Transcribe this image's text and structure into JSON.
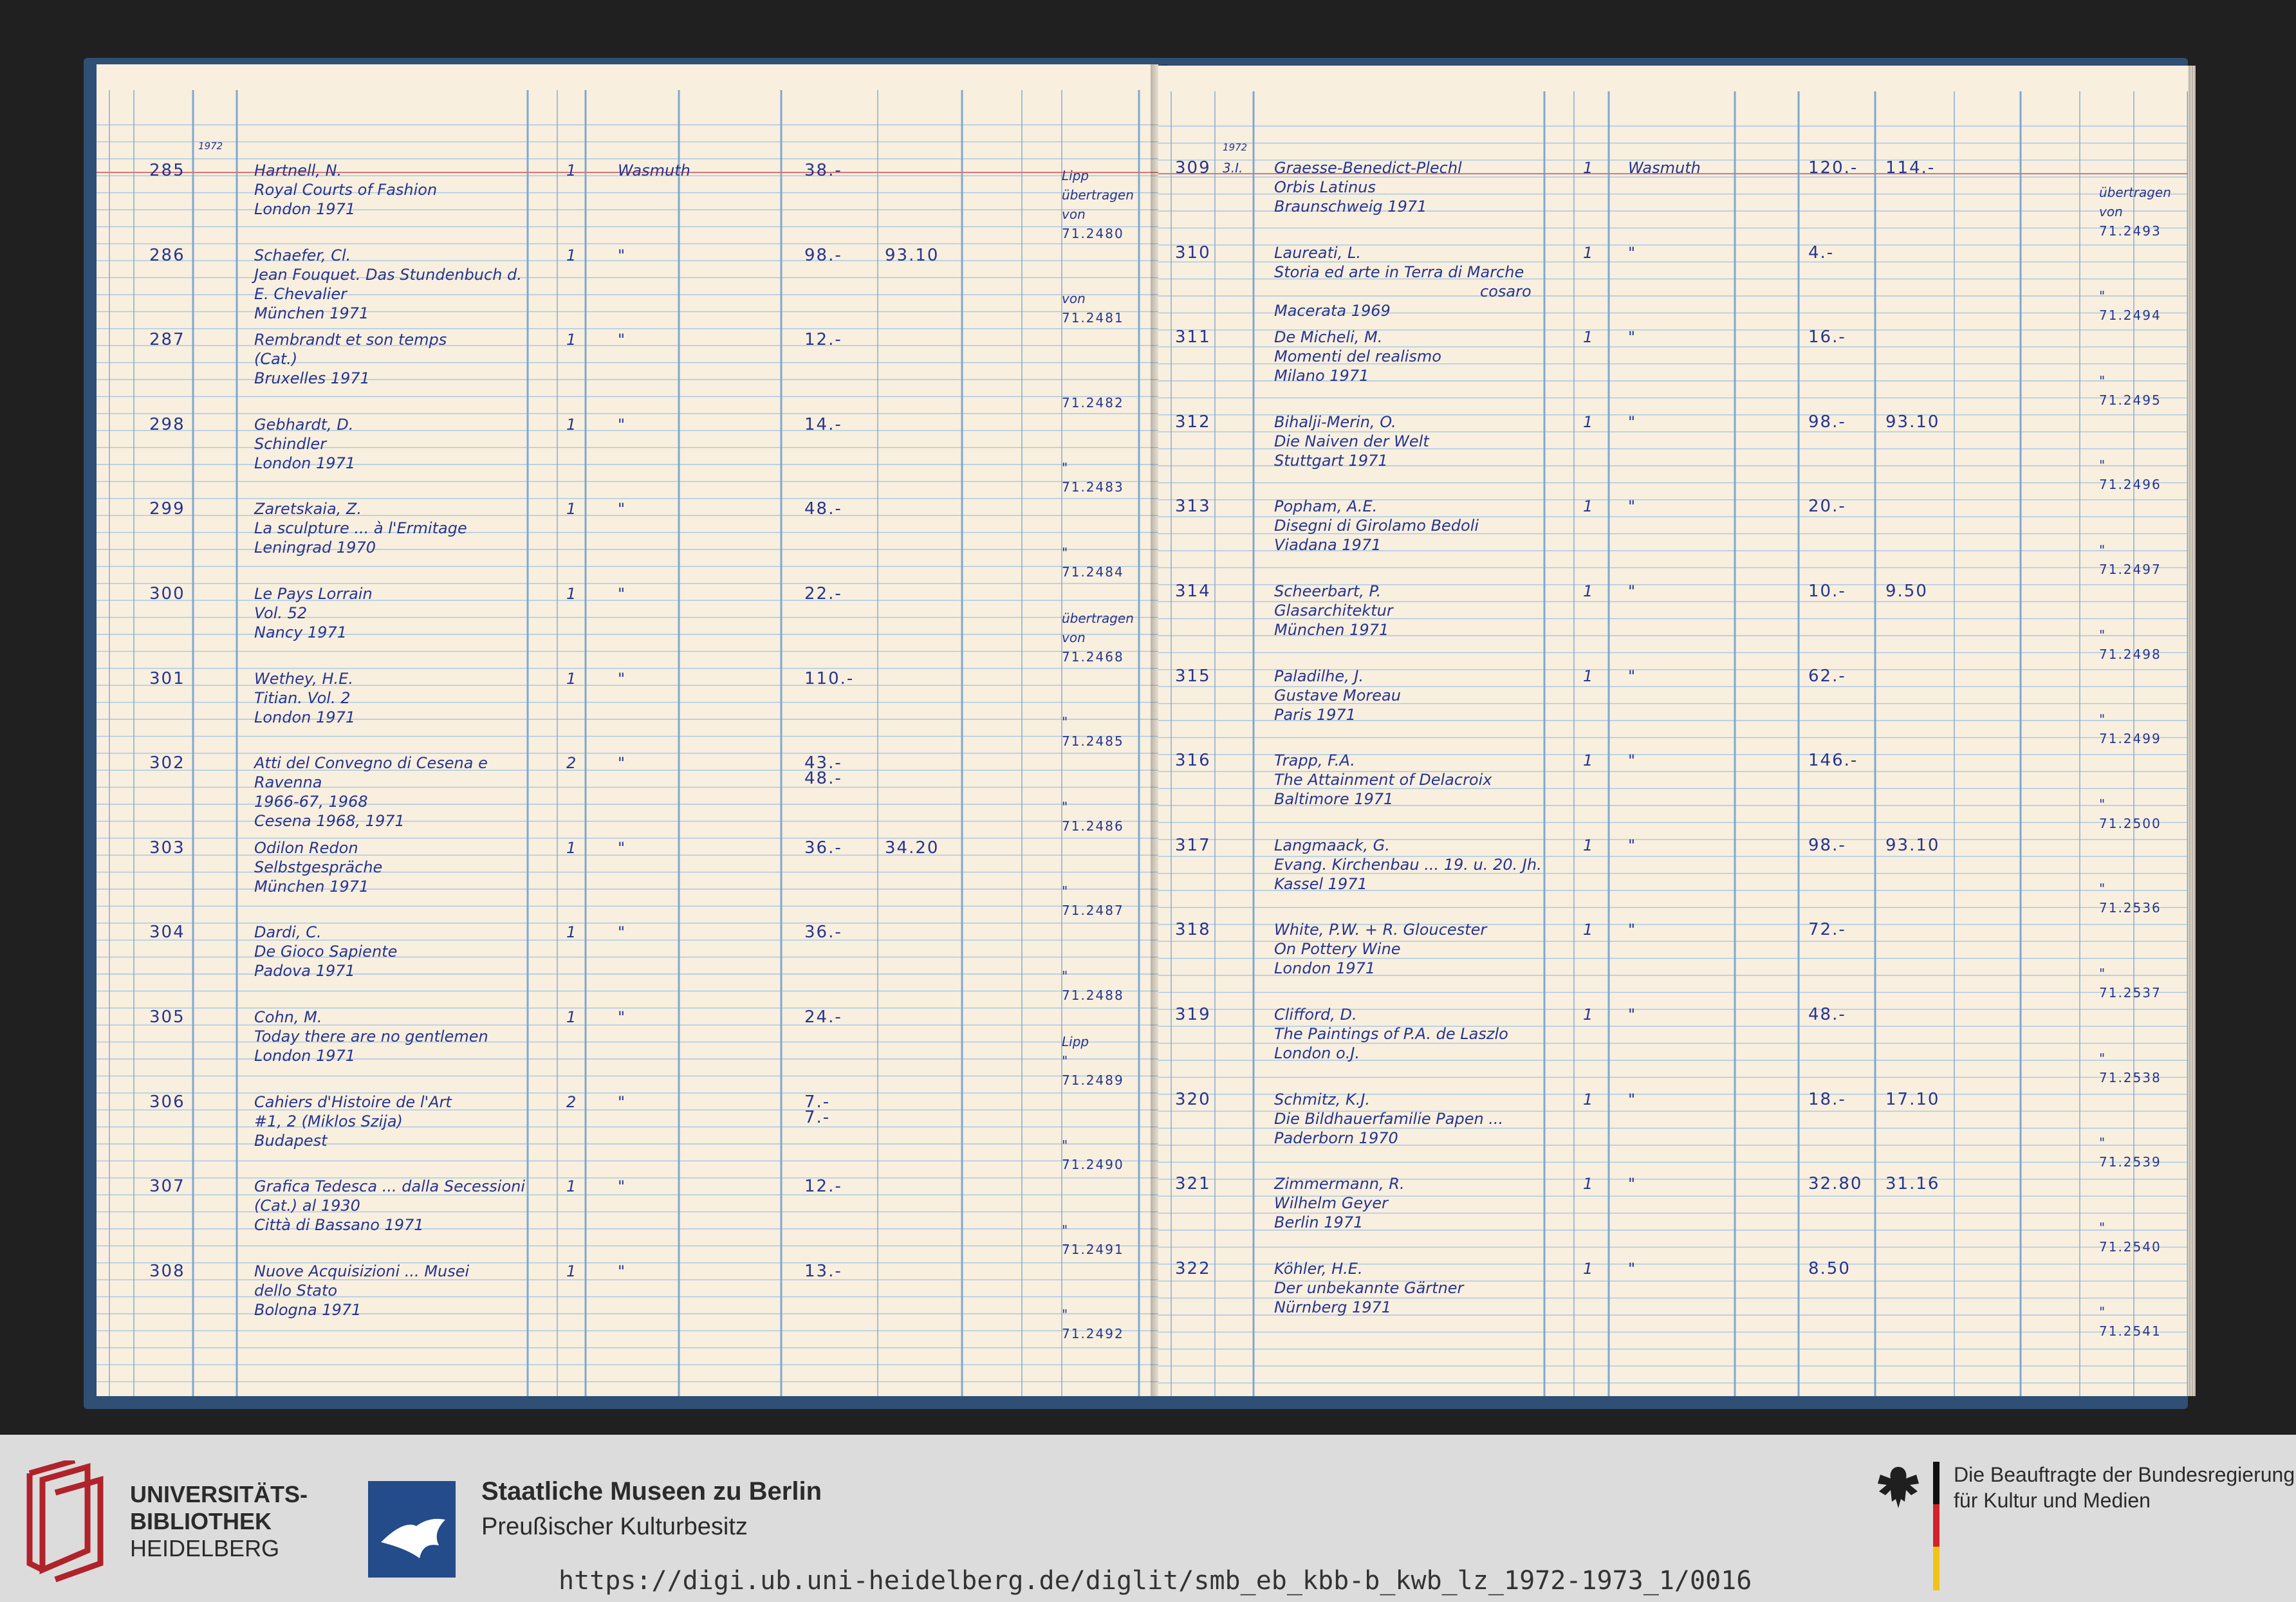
{
  "left_page": {
    "year": "1972",
    "entries": [
      {
        "no": "285",
        "lines": [
          "Hartnell, N.",
          "Royal Courts of Fashion",
          "London 1971"
        ],
        "count": "1",
        "dealer": "Wasmuth",
        "price": "38.-",
        "net": "",
        "remark": [
          "Lipp",
          "übertragen",
          "von",
          "71.2480"
        ]
      },
      {
        "no": "286",
        "lines": [
          "Schaefer, Cl.",
          "Jean Fouquet. Das Stundenbuch d.",
          "E. Chevalier",
          "München 1971"
        ],
        "count": "1",
        "dealer": "\"",
        "price": "98.-",
        "net": "93.10",
        "remark": [
          "von",
          "71.2481"
        ]
      },
      {
        "no": "287",
        "lines": [
          "Rembrandt et son temps",
          "(Cat.)",
          "Bruxelles 1971"
        ],
        "count": "1",
        "dealer": "\"",
        "price": "12.-",
        "net": "",
        "remark": [
          "71.2482"
        ]
      },
      {
        "no": "298",
        "lines": [
          "Gebhardt, D.",
          "Schindler",
          "London 1971"
        ],
        "count": "1",
        "dealer": "\"",
        "price": "14.-",
        "net": "",
        "remark": [
          "\"",
          "71.2483"
        ]
      },
      {
        "no": "299",
        "lines": [
          "Zaretskaia, Z.",
          "La sculpture ... à l'Ermitage",
          "Leningrad 1970"
        ],
        "count": "1",
        "dealer": "\"",
        "price": "48.-",
        "net": "",
        "remark": [
          "\"",
          "71.2484"
        ]
      },
      {
        "no": "300",
        "lines": [
          "Le Pays Lorrain",
          "Vol. 52",
          "Nancy 1971"
        ],
        "count": "1",
        "dealer": "\"",
        "price": "22.-",
        "net": "",
        "remark": [
          "übertragen",
          "von",
          "71.2468"
        ]
      },
      {
        "no": "301",
        "lines": [
          "Wethey, H.E.",
          "Titian. Vol. 2",
          "London 1971"
        ],
        "count": "1",
        "dealer": "\"",
        "price": "110.-",
        "net": "",
        "remark": [
          "\"",
          "71.2485"
        ]
      },
      {
        "no": "302",
        "lines": [
          "Atti del Convegno di Cesena e",
          "Ravenna",
          "1966-67, 1968",
          "Cesena 1968, 1971"
        ],
        "count": "2",
        "dealer": "\"",
        "price": "43.- / 48.-",
        "net": "",
        "remark": [
          "\"",
          "71.2486"
        ]
      },
      {
        "no": "303",
        "lines": [
          "Odilon Redon",
          "Selbstgespräche",
          "München 1971"
        ],
        "count": "1",
        "dealer": "\"",
        "price": "36.-",
        "net": "34.20",
        "remark": [
          "\"",
          "71.2487"
        ]
      },
      {
        "no": "304",
        "lines": [
          "Dardi, C.",
          "De Gioco Sapiente",
          "Padova 1971"
        ],
        "count": "1",
        "dealer": "\"",
        "price": "36.-",
        "net": "",
        "remark": [
          "\"",
          "71.2488"
        ]
      },
      {
        "no": "305",
        "lines": [
          "Cohn, M.",
          "Today there are no gentlemen",
          "London 1971"
        ],
        "count": "1",
        "dealer": "\"",
        "price": "24.-",
        "net": "",
        "remark": [
          "Lipp",
          "\"",
          "71.2489"
        ]
      },
      {
        "no": "306",
        "lines": [
          "Cahiers d'Histoire de l'Art",
          "#1, 2    (Miklos Szija)",
          "Budapest"
        ],
        "count": "2",
        "dealer": "\"",
        "price": "7.- / 7.-",
        "net": "",
        "remark": [
          "\"",
          "71.2490"
        ]
      },
      {
        "no": "307",
        "lines": [
          "Grafica Tedesca ... dalla Secessioni",
          "(Cat.)           al 1930",
          "Città di Bassano 1971"
        ],
        "count": "1",
        "dealer": "\"",
        "price": "12.-",
        "net": "",
        "remark": [
          "\"",
          "71.2491"
        ]
      },
      {
        "no": "308",
        "lines": [
          "Nuove Acquisizioni ... Musei",
          "dello Stato",
          "Bologna 1971"
        ],
        "count": "1",
        "dealer": "\"",
        "price": "13.-",
        "net": "",
        "remark": [
          "\"",
          "71.2492"
        ]
      }
    ]
  },
  "right_page": {
    "year": "1972",
    "entries": [
      {
        "no": "309",
        "mark": "3.I.",
        "lines": [
          "Graesse-Benedict-Plechl",
          "Orbis Latinus",
          "Braunschweig 1971"
        ],
        "count": "1",
        "dealer": "Wasmuth",
        "price": "120.-",
        "net": "114.-",
        "remark": [
          "übertragen",
          "von",
          "71.2493"
        ]
      },
      {
        "no": "310",
        "lines": [
          "Laureati, L.",
          "Storia ed arte in Terra di Marche",
          "cosaro",
          "Macerata 1969"
        ],
        "count": "1",
        "dealer": "\"",
        "price": "4.-",
        "net": "",
        "remark": [
          "\"",
          "71.2494"
        ]
      },
      {
        "no": "311",
        "lines": [
          "De Micheli, M.",
          "Momenti del realismo",
          "Milano 1971"
        ],
        "count": "1",
        "dealer": "\"",
        "price": "16.-",
        "net": "",
        "remark": [
          "\"",
          "71.2495"
        ]
      },
      {
        "no": "312",
        "lines": [
          "Bihalji-Merin, O.",
          "Die Naiven der Welt",
          "Stuttgart 1971"
        ],
        "count": "1",
        "dealer": "\"",
        "price": "98.-",
        "net": "93.10",
        "remark": [
          "\"",
          "71.2496"
        ]
      },
      {
        "no": "313",
        "lines": [
          "Popham, A.E.",
          "Disegni di Girolamo Bedoli",
          "Viadana 1971"
        ],
        "count": "1",
        "dealer": "\"",
        "price": "20.-",
        "net": "",
        "remark": [
          "\"",
          "71.2497"
        ]
      },
      {
        "no": "314",
        "lines": [
          "Scheerbart, P.",
          "Glasarchitektur",
          "München 1971"
        ],
        "count": "1",
        "dealer": "\"",
        "price": "10.-",
        "net": "9.50",
        "remark": [
          "\"",
          "71.2498"
        ]
      },
      {
        "no": "315",
        "lines": [
          "Paladilhe, J.",
          "Gustave Moreau",
          "Paris 1971"
        ],
        "count": "1",
        "dealer": "\"",
        "price": "62.-",
        "net": "",
        "remark": [
          "\"",
          "71.2499"
        ]
      },
      {
        "no": "316",
        "lines": [
          "Trapp, F.A.",
          "The Attainment of Delacroix",
          "Baltimore 1971"
        ],
        "count": "1",
        "dealer": "\"",
        "price": "146.-",
        "net": "",
        "remark": [
          "\"",
          "71.2500"
        ]
      },
      {
        "no": "317",
        "lines": [
          "Langmaack, G.",
          "Evang. Kirchenbau ... 19. u. 20. Jh.",
          "Kassel 1971"
        ],
        "count": "1",
        "dealer": "\"",
        "price": "98.-",
        "net": "93.10",
        "remark": [
          "\"",
          "71.2536"
        ]
      },
      {
        "no": "318",
        "lines": [
          "White, P.W. + R. Gloucester",
          "On Pottery Wine",
          "London 1971"
        ],
        "count": "1",
        "dealer": "\"",
        "price": "72.-",
        "net": "",
        "remark": [
          "\"",
          "71.2537"
        ]
      },
      {
        "no": "319",
        "lines": [
          "Clifford, D.",
          "The Paintings of P.A. de Laszlo",
          "London o.J."
        ],
        "count": "1",
        "dealer": "\"",
        "price": "48.-",
        "net": "",
        "remark": [
          "\"",
          "71.2538"
        ]
      },
      {
        "no": "320",
        "lines": [
          "Schmitz, K.J.",
          "Die Bildhauerfamilie Papen ...",
          "Paderborn 1970"
        ],
        "count": "1",
        "dealer": "\"",
        "price": "18.-",
        "net": "17.10",
        "remark": [
          "\"",
          "71.2539"
        ]
      },
      {
        "no": "321",
        "lines": [
          "Zimmermann, R.",
          "Wilhelm Geyer",
          "Berlin 1971"
        ],
        "count": "1",
        "dealer": "\"",
        "price": "32.80",
        "net": "31.16",
        "remark": [
          "\"",
          "71.2540"
        ]
      },
      {
        "no": "322",
        "lines": [
          "Köhler, H.E.",
          "Der unbekannte Gärtner",
          "Nürnberg 1971"
        ],
        "count": "1",
        "dealer": "\"",
        "price": "8.50",
        "net": "",
        "remark": [
          "\"",
          "71.2541"
        ]
      }
    ]
  },
  "footer": {
    "ub_line1": "UNIVERSITÄTS-",
    "ub_line2": "BIBLIOTHEK",
    "ub_line3": "HEIDELBERG",
    "smb_title": "Staatliche Museen zu Berlin",
    "smb_subtitle": "Preußischer Kulturbesitz",
    "bkm_line1": "Die Beauftragte der Bundesregierung",
    "bkm_line2": "für Kultur und Medien",
    "url": "https://digi.ub.uni-heidelberg.de/diglit/smb_eb_kbb-b_kwb_lz_1972-1973_1/0016",
    "colors": {
      "footer_bg": "#dcdcdc",
      "ub_red": "#b0232a",
      "smb_blue": "#244b8a",
      "ink": "#27358f",
      "paper": "#f8efdf",
      "grid": "#9fc0dc"
    }
  }
}
